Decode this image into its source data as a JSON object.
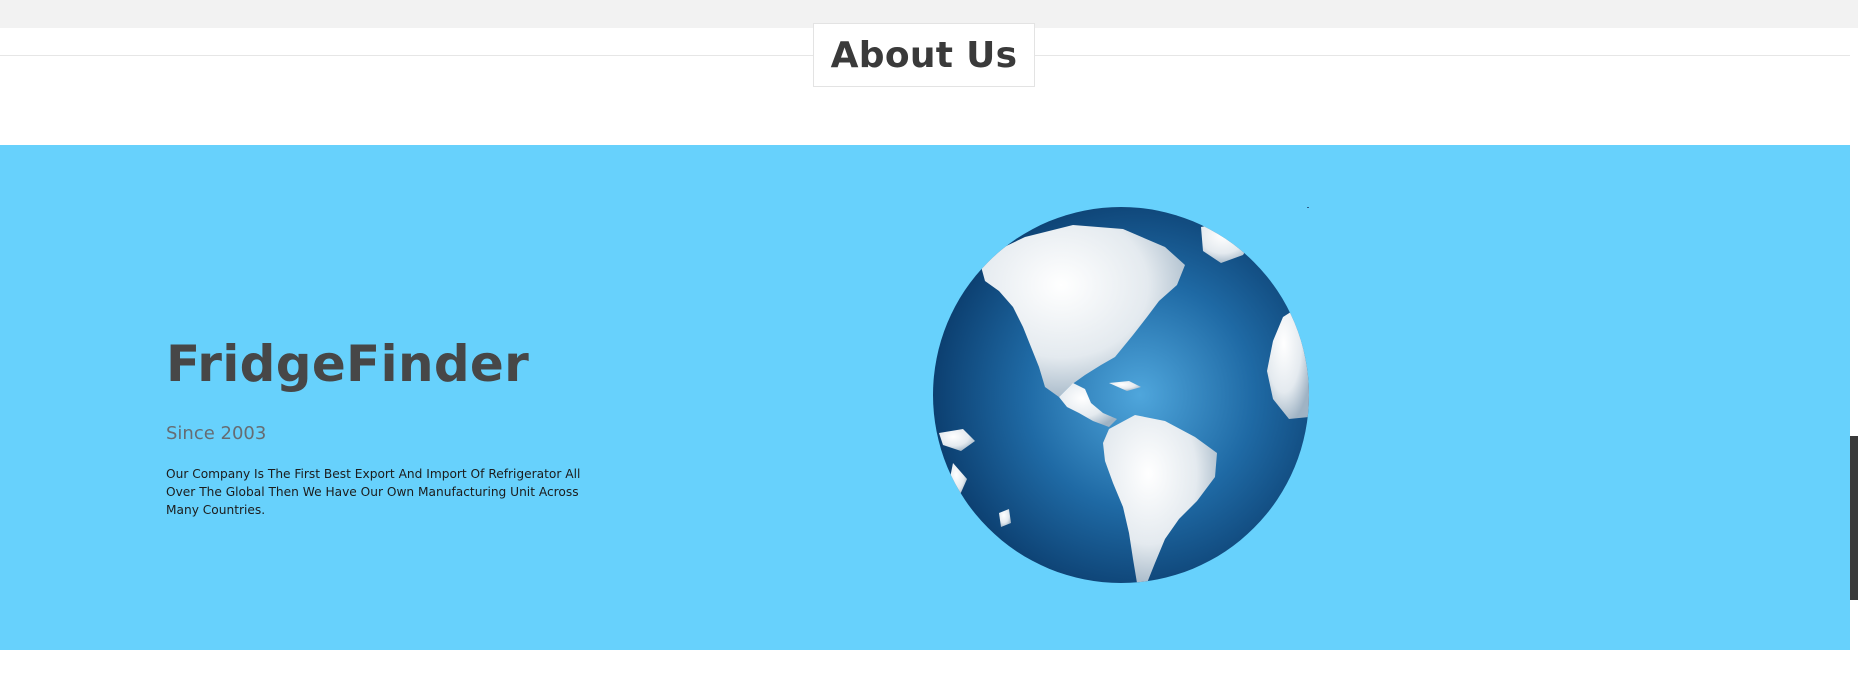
{
  "header": {
    "title": "About Us"
  },
  "hero": {
    "brand": "FridgeFinder",
    "since": "Since 2003",
    "description": "Our Company Is The First Best Export And Import Of Refrigerator All Over The Global Then We Have Our Own Manufacturing Unit Across Many Countries."
  },
  "colors": {
    "hero_background": "#67d1fc",
    "heading_text": "#474747",
    "globe_ocean": "#1d6aa6",
    "globe_land": "#eef2f5"
  },
  "icons": {
    "globe": "globe-image"
  }
}
